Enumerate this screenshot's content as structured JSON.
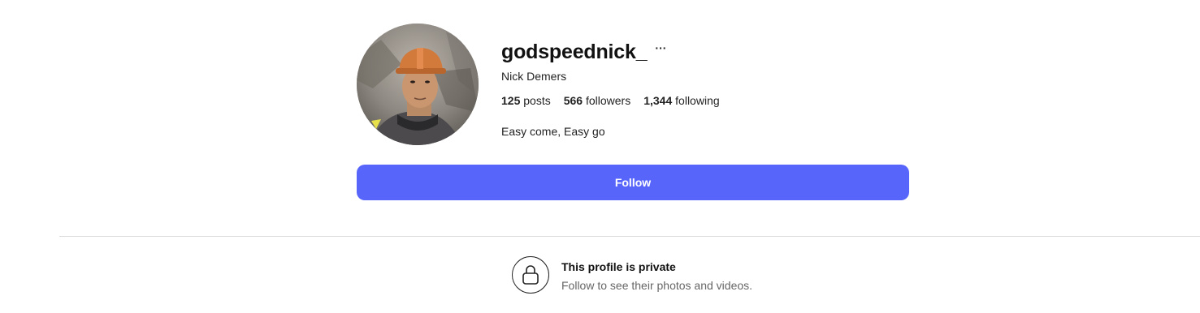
{
  "profile": {
    "username": "godspeednick_",
    "more_label": "···",
    "full_name": "Nick Demers",
    "stats": [
      {
        "count": "125",
        "label": "posts"
      },
      {
        "count": "566",
        "label": "followers"
      },
      {
        "count": "1,344",
        "label": "following"
      }
    ],
    "bio": "Easy come, Easy go",
    "follow_label": "Follow"
  },
  "private_notice": {
    "title": "This profile is private",
    "subtitle": "Follow to see their photos and videos."
  },
  "colors": {
    "accent": "#5865fb",
    "divider": "#dcdcdc",
    "muted_text": "#666666"
  },
  "icons": {
    "lock": "lock-icon",
    "more": "more-icon"
  }
}
